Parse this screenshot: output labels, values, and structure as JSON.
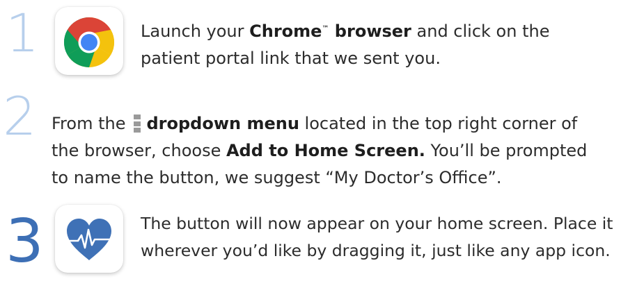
{
  "steps": [
    {
      "number": "1",
      "icon": "chrome-icon",
      "line1_a": "Launch your ",
      "line1_bold1": "Chrome",
      "line1_tm": "™",
      "line1_bold2": " browser",
      "line1_b": " and click on the",
      "line2": "patient portal link that we sent you."
    },
    {
      "number": "2",
      "icon": "menu-dots-icon",
      "line1_a": "From the",
      "line1_bold": "dropdown menu",
      "line1_b": " located in the top right corner of",
      "line2_a": "the browser, choose ",
      "line2_bold": "Add to Home Screen.",
      "line2_b": " You’ll be prompted",
      "line3": "to name the button, we suggest “My Doctor’s Office”."
    },
    {
      "number": "3",
      "icon": "heart-pulse-icon",
      "line1": "The button will now appear on your home screen. Place it",
      "line2": "wherever you’d like by dragging it, just like any app icon."
    }
  ],
  "colors": {
    "step_number_light": "#b7cfec",
    "step_number_dark": "#3d6fb5",
    "heart": "#3f71b6",
    "chrome_red": "#db4437",
    "chrome_yellow": "#f4c20d",
    "chrome_green": "#0f9d58",
    "chrome_blue": "#4285f4"
  }
}
